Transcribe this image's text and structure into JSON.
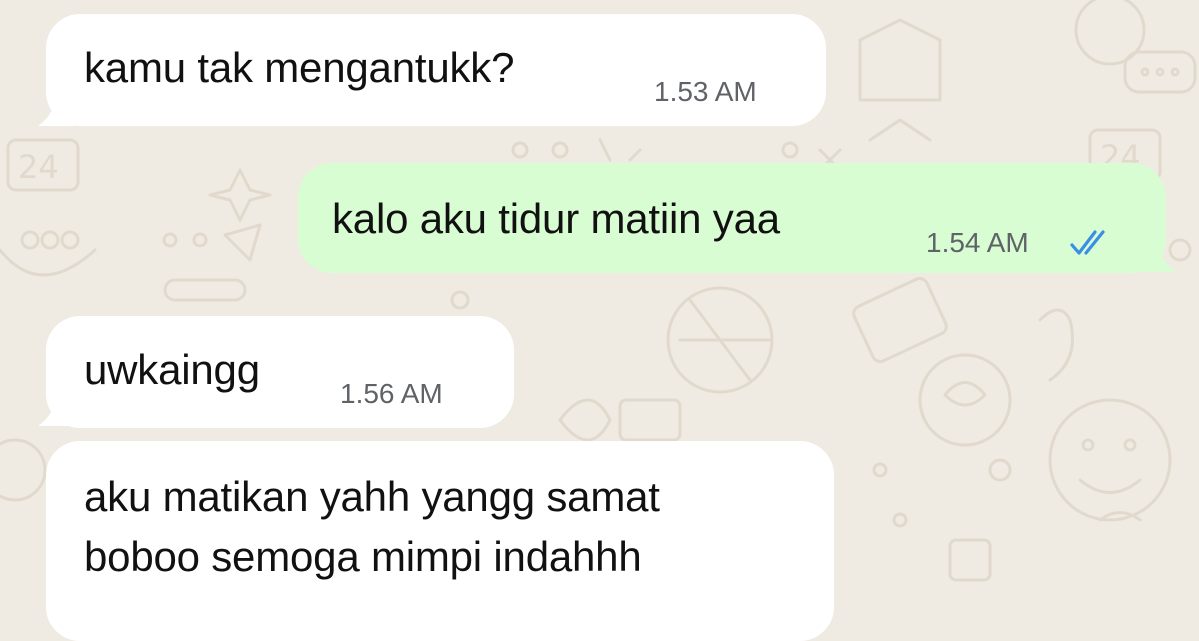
{
  "messages": [
    {
      "id": "m1",
      "direction": "incoming",
      "text": "kamu tak mengantukk?",
      "time": "1.53 AM"
    },
    {
      "id": "m2",
      "direction": "outgoing",
      "text": "kalo aku tidur matiin yaa",
      "time": "1.54 AM",
      "status": "read",
      "status_icon": "double-check-icon"
    },
    {
      "id": "m3",
      "direction": "incoming",
      "text": "uwkaingg",
      "time": "1.56 AM"
    },
    {
      "id": "m4",
      "direction": "incoming",
      "text_lines": [
        "aku matikan yahh yangg samat",
        "boboo semoga mimpi indahhh"
      ]
    }
  ],
  "colors": {
    "chat_background": "#efeae2",
    "incoming_bubble": "#ffffff",
    "outgoing_bubble": "#d9fdd3",
    "read_ticks": "#3b8ee6",
    "timestamp": "#5f6368"
  }
}
